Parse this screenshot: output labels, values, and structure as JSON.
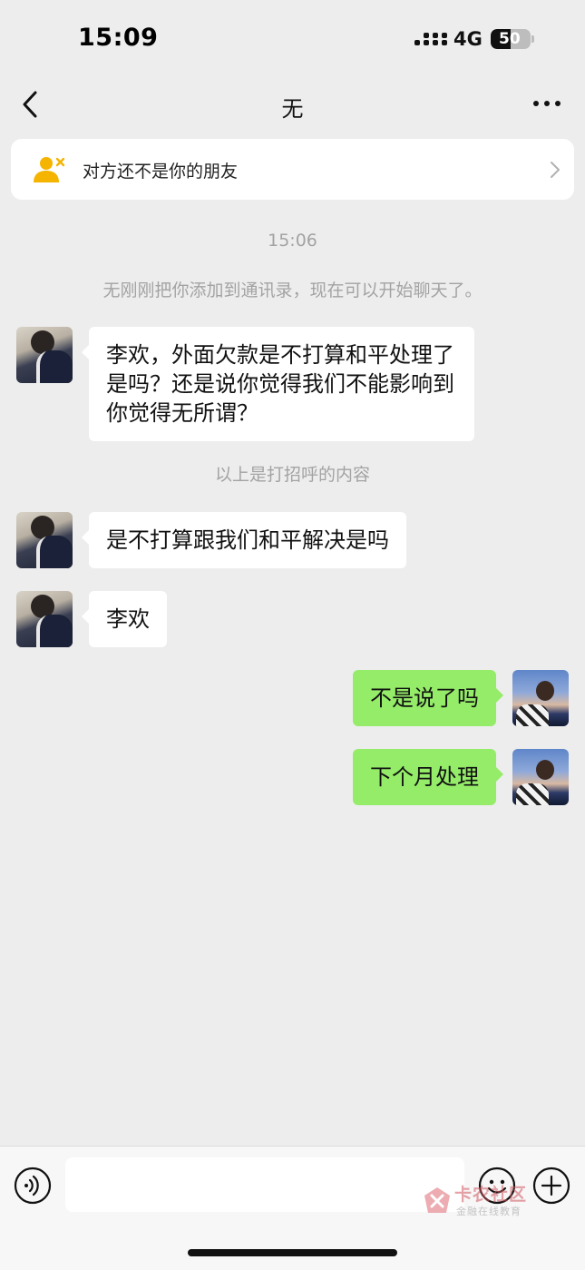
{
  "status_bar": {
    "time": "15:09",
    "network": "4G",
    "battery": "50",
    "battery_level": 0.5
  },
  "nav": {
    "title": "无"
  },
  "banner": {
    "text": "对方还不是你的朋友"
  },
  "system": {
    "timestamp": "15:06",
    "added_notice": "无刚刚把你添加到通讯录，现在可以开始聊天了。",
    "greeting_notice": "以上是打招呼的内容"
  },
  "messages": [
    {
      "side": "left",
      "text": "李欢，外面欠款是不打算和平处理了是吗？还是说你觉得我们不能影响到你觉得无所谓？"
    },
    {
      "side": "left",
      "text": "是不打算跟我们和平解决是吗"
    },
    {
      "side": "left",
      "text": "李欢"
    },
    {
      "side": "right",
      "text": "不是说了吗"
    },
    {
      "side": "right",
      "text": "下个月处理"
    }
  ],
  "input": {
    "value": "",
    "placeholder": ""
  },
  "watermark": {
    "title": "卡农社区",
    "subtitle": "金融在线教育"
  },
  "colors": {
    "background": "#ededed",
    "sent_bubble": "#95ec69",
    "received_bubble": "#ffffff",
    "banner_icon": "#f5b400"
  }
}
